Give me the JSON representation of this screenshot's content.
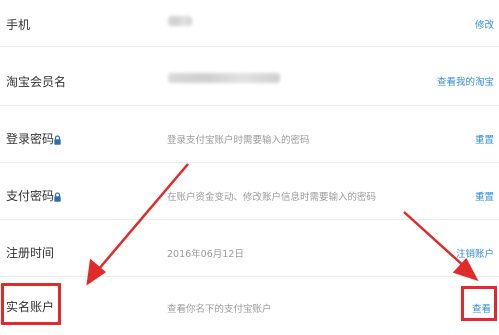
{
  "rows": [
    {
      "label": "手机",
      "action": "修改"
    },
    {
      "label": "淘宝会员名",
      "action": "查看我的淘宝"
    },
    {
      "label": "登录密码",
      "desc": "登录支付宝账户时需要输入的密码",
      "action": "重置"
    },
    {
      "label": "支付密码",
      "desc": "在账户资金变动、修改账户信息时需要输入的密码",
      "action": "重置"
    },
    {
      "label": "注册时间",
      "desc": "2016年06月12日",
      "action": "注销账户"
    },
    {
      "label": "实名账户",
      "desc": "查看你名下的支付宝账户",
      "action": "查看"
    }
  ],
  "icons": {
    "lock": "lock-icon"
  },
  "colors": {
    "link": "#2f8bd8",
    "highlight": "#e12a2a",
    "muted": "#9a9a9a"
  }
}
